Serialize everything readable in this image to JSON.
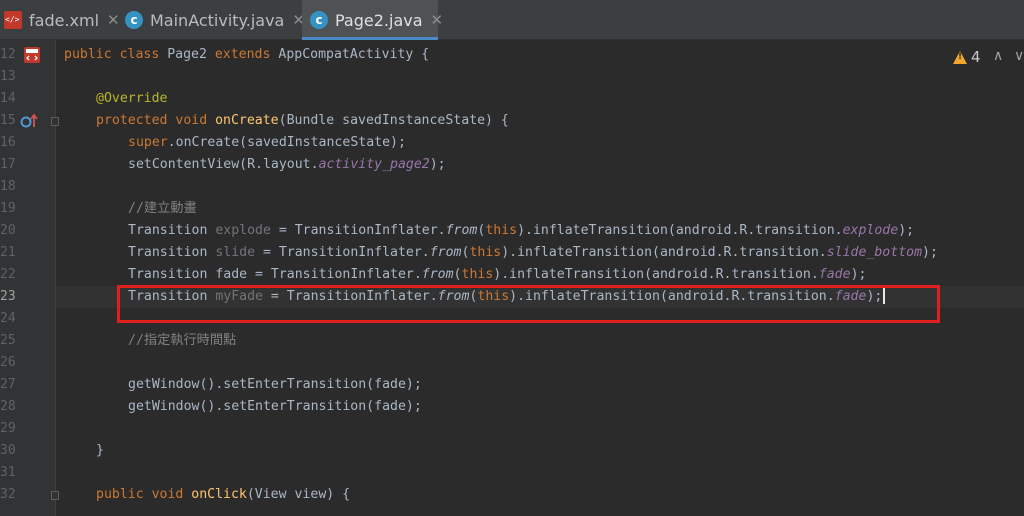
{
  "tabs": [
    {
      "label": "fade.xml",
      "icon": "xml-file-icon",
      "active": false
    },
    {
      "label": "MainActivity.java",
      "icon": "java-class-icon",
      "active": false
    },
    {
      "label": "Page2.java",
      "icon": "java-class-icon",
      "active": true
    }
  ],
  "tab_close_glyph": "✕",
  "class_icon_letter": "c",
  "inspections": {
    "warning_count": "4"
  },
  "gutter": {
    "line_numbers": [
      "12",
      "13",
      "14",
      "15",
      "16",
      "17",
      "18",
      "19",
      "20",
      "21",
      "22",
      "23",
      "24",
      "25",
      "26",
      "27",
      "28",
      "29",
      "30",
      "31",
      "32"
    ],
    "current_line": "23"
  },
  "code": {
    "l12": {
      "kw1": "public class ",
      "name": "Page2 ",
      "kw2": "extends ",
      "rest": "AppCompatActivity {"
    },
    "l14": {
      "annotation": "@Override"
    },
    "l15": {
      "kw": "protected void ",
      "fn": "onCreate",
      "rest": "(Bundle savedInstanceState) {"
    },
    "l16": {
      "kw": "super",
      "rest": ".onCreate(savedInstanceState);"
    },
    "l17": {
      "a": "setContentView(R.layout.",
      "field": "activity_page2",
      "b": ");"
    },
    "l19": {
      "comment": "//建立動畫"
    },
    "l20": {
      "type": "Transition ",
      "var": "explode",
      "eq": " = TransitionInflater.",
      "from": "from",
      "p1": "(",
      "this": "this",
      "p2": ").inflateTransition(android.R.transition.",
      "field": "explode",
      "end": ");"
    },
    "l21": {
      "type": "Transition ",
      "var": "slide",
      "eq": " = TransitionInflater.",
      "from": "from",
      "p1": "(",
      "this": "this",
      "p2": ").inflateTransition(android.R.transition.",
      "field": "slide_bottom",
      "end": ");"
    },
    "l22": {
      "type": "Transition ",
      "var": "fade",
      "eq": " = TransitionInflater.",
      "from": "from",
      "p1": "(",
      "this": "this",
      "p2": ").inflateTransition(android.R.transition.",
      "field": "fade",
      "end": ");"
    },
    "l23": {
      "type": "Transition ",
      "var": "myFade",
      "eq": " = TransitionInflater.",
      "from": "from",
      "p1": "(",
      "this": "this",
      "p2": ").inflateTransition(android.R.transition.",
      "field": "fade",
      "end": ");"
    },
    "l25": {
      "comment": "//指定執行時間點"
    },
    "l27": {
      "text": "getWindow().setEnterTransition(fade);"
    },
    "l28": {
      "text": "getWindow().setEnterTransition(fade);"
    },
    "l30": {
      "text": "}"
    },
    "l32": {
      "kw": "public void ",
      "fn": "onClick",
      "rest": "(View view) {"
    }
  }
}
